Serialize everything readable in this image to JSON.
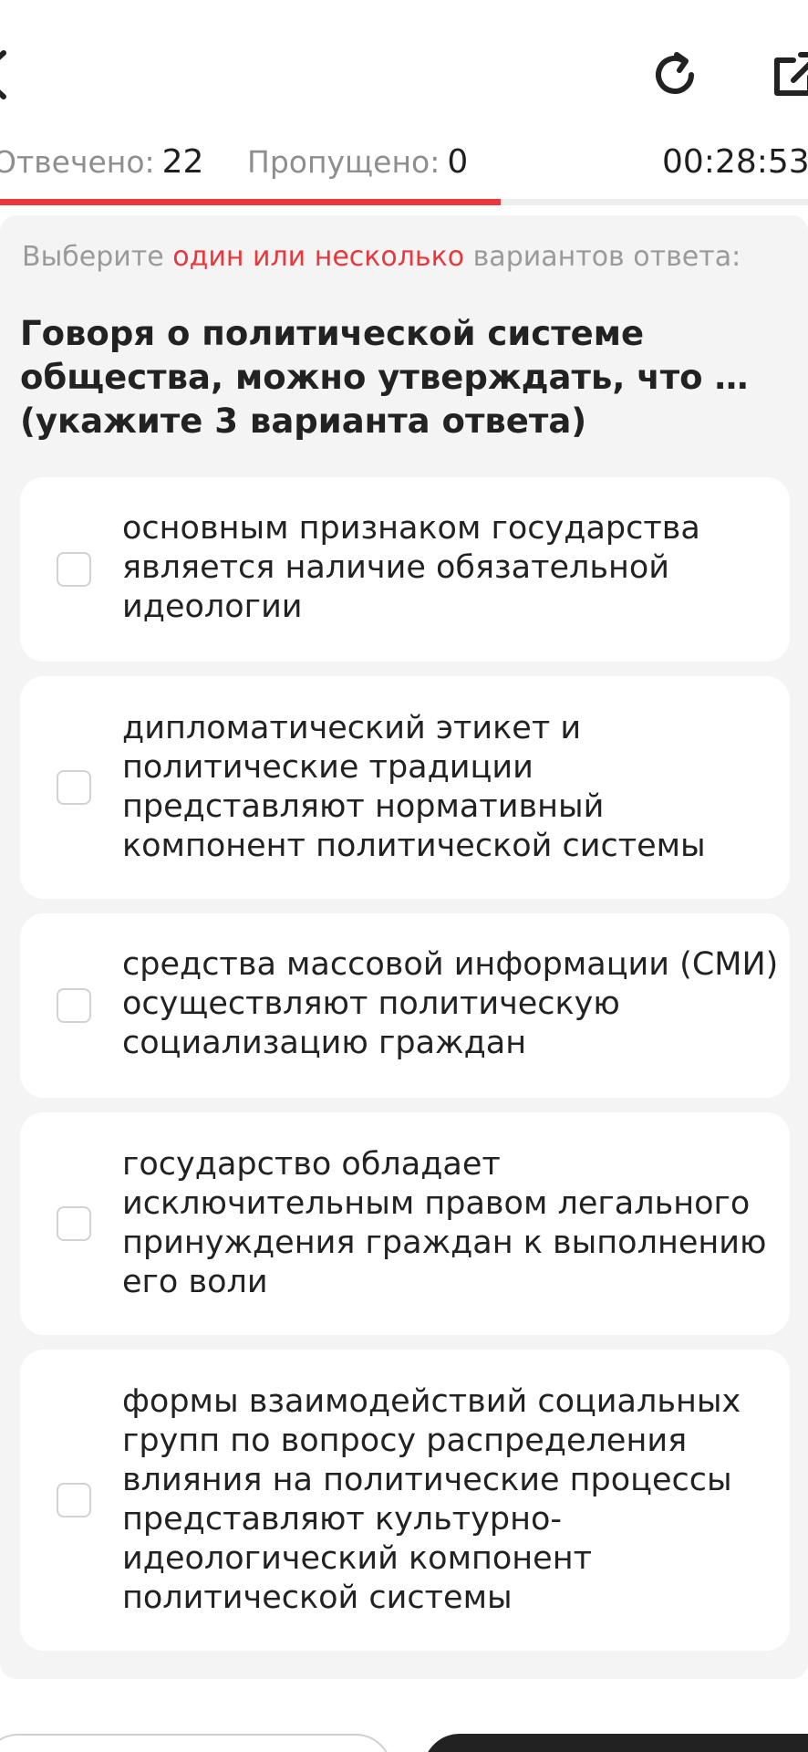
{
  "header": {
    "answered_label": "Отвечено:",
    "answered_value": "22",
    "skipped_label": "Пропущено:",
    "skipped_value": "0",
    "timer": "00:28:53",
    "progress_fraction": 0.62
  },
  "question": {
    "instruction_prefix": "Выберите",
    "instruction_accent": "один или несколько",
    "instruction_suffix": "вариантов ответа:",
    "text": "Говоря о политической системе общества, можно утверждать, что … (укажите 3 варианта ответа)"
  },
  "options": [
    {
      "label": "основным признаком государства является наличие обязательной идеологии",
      "checked": false
    },
    {
      "label": "дипломатический этикет и политические традиции представляют нормативный компонент политической системы",
      "checked": false
    },
    {
      "label": "средства массовой информации (СМИ) осуществляют политическую социализацию граждан",
      "checked": false
    },
    {
      "label": "государство обладает исключительным правом легального принуждения граждан к выполнению его воли",
      "checked": false
    },
    {
      "label": "формы взаимодействий социальных групп по вопросу распределения влияния на политические процессы представляют культурно-идеологический компонент политической системы",
      "checked": false
    }
  ],
  "colors": {
    "accent": "#e8383d",
    "panel": "#f4f4f4",
    "text": "#222222",
    "muted": "#9a9a9a"
  },
  "icons": [
    "back-icon",
    "refresh-icon",
    "share-icon"
  ]
}
